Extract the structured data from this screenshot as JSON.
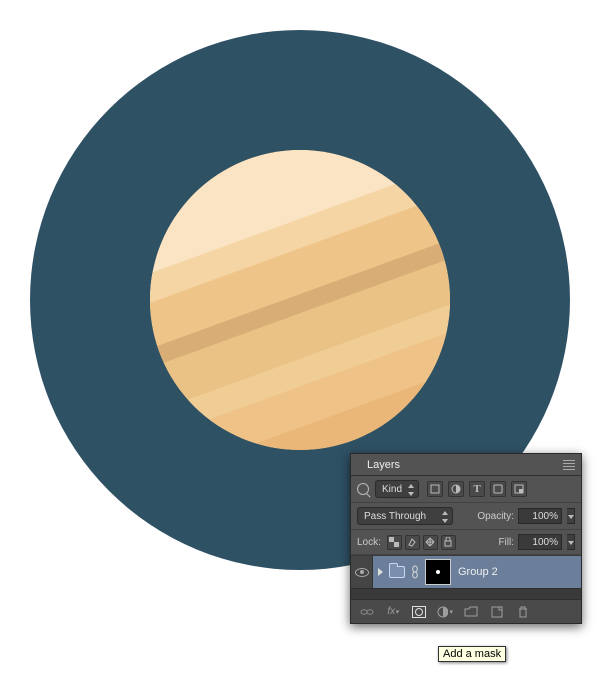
{
  "canvas": {
    "bg_circle_color": "#2f5164",
    "planet_base_color": "#efc489"
  },
  "panel": {
    "title": "Layers",
    "filter": {
      "kind_label": "Kind",
      "icons": [
        "pixel-layer-icon",
        "adjustment-layer-icon",
        "type-layer-icon",
        "shape-layer-icon",
        "smart-object-icon"
      ]
    },
    "blend": {
      "mode": "Pass Through",
      "opacity_label": "Opacity:",
      "opacity_value": "100%"
    },
    "lock": {
      "label": "Lock:",
      "fill_label": "Fill:",
      "fill_value": "100%"
    },
    "layer": {
      "name": "Group 2"
    },
    "footer_icons": [
      "link-icon",
      "fx-icon",
      "mask-icon",
      "adjustment-icon",
      "group-icon",
      "new-layer-icon",
      "trash-icon"
    ],
    "tooltip": "Add a mask"
  }
}
